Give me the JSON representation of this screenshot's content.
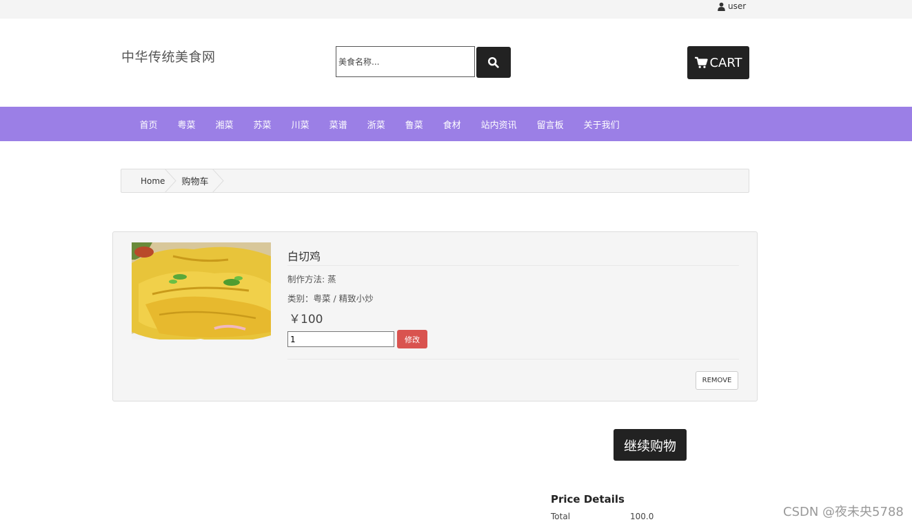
{
  "header": {
    "user_label": "user",
    "site_title": "中华传统美食网",
    "search_placeholder": "美食名称...",
    "cart_label": "CART"
  },
  "nav": {
    "items": [
      "首页",
      "粤菜",
      "湘菜",
      "苏菜",
      "川菜",
      "菜谱",
      "浙菜",
      "鲁菜",
      "食材",
      "站内资讯",
      "留言板",
      "关于我们"
    ]
  },
  "breadcrumb": {
    "home": "Home",
    "current": "购物车"
  },
  "cart_item": {
    "name": "白切鸡",
    "method": "制作方法: 蒸",
    "category": "类别：粤菜 / 精致小炒",
    "price": "￥100",
    "quantity": "1",
    "modify_label": "修改",
    "remove_label": "REMOVE"
  },
  "actions": {
    "continue_label": "继续购物"
  },
  "price_details": {
    "title": "Price Details",
    "total_label": "Total",
    "total_value": "100.0"
  },
  "watermark": "CSDN @夜未央5788",
  "colors": {
    "nav_bg": "#9b7fe6",
    "dark_button": "#222222",
    "danger_button": "#d9534f"
  },
  "icons": {
    "user": "user-icon",
    "search": "search-icon",
    "cart": "cart-icon"
  }
}
